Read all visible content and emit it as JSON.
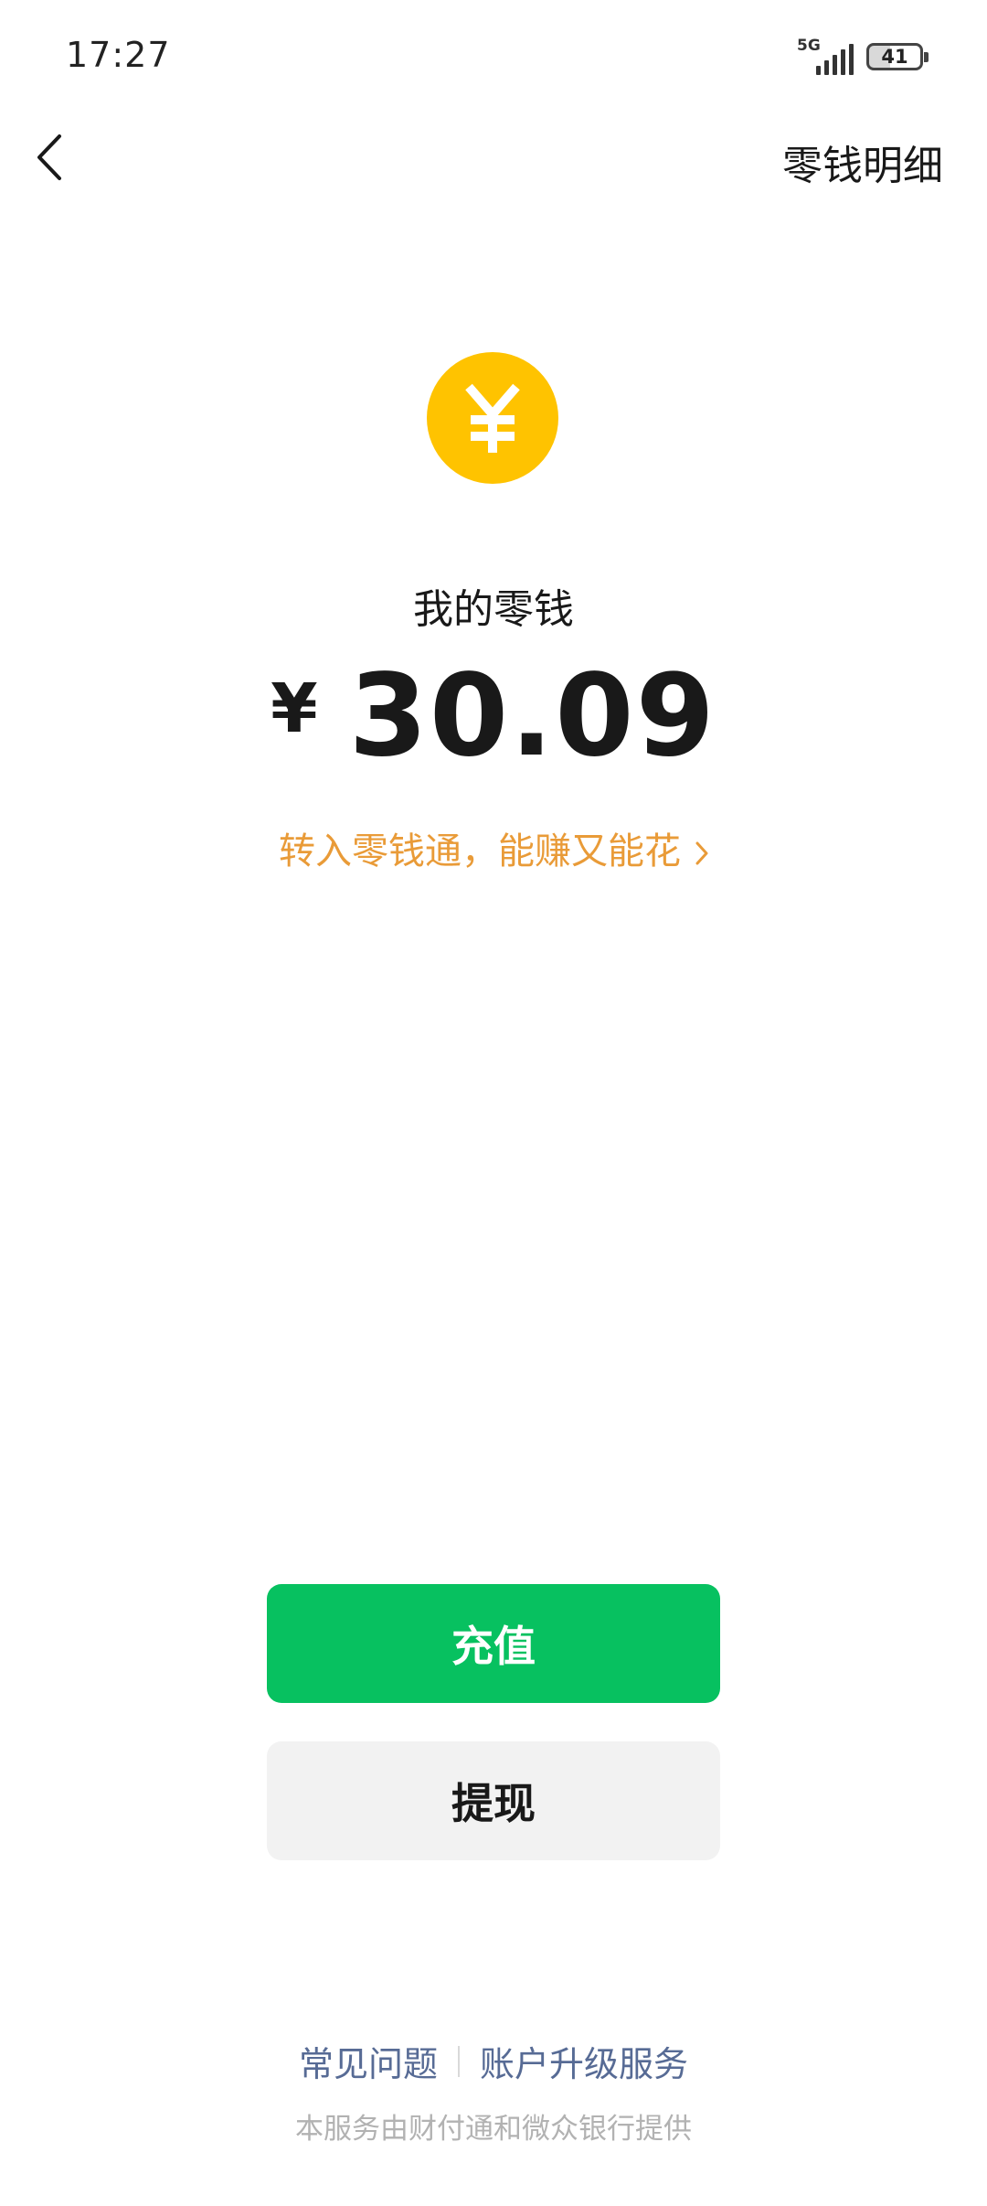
{
  "status_bar": {
    "time": "17:27",
    "network": "5G",
    "battery": "41"
  },
  "nav": {
    "back_icon": "chevron-left-icon",
    "action_label": "零钱明细"
  },
  "balance": {
    "coin_icon": "yuan-coin-icon",
    "coin_color": "#ffc300",
    "label": "我的零钱",
    "currency": "¥",
    "amount": "30.09",
    "promo_text": "转入零钱通，能赚又能花",
    "promo_color": "#e99b38"
  },
  "actions": {
    "recharge_label": "充值",
    "recharge_color": "#07c160",
    "withdraw_label": "提现"
  },
  "footer": {
    "faq_label": "常见问题",
    "upgrade_label": "账户升级服务",
    "note": "本服务由财付通和微众银行提供",
    "link_color": "#576b95"
  }
}
